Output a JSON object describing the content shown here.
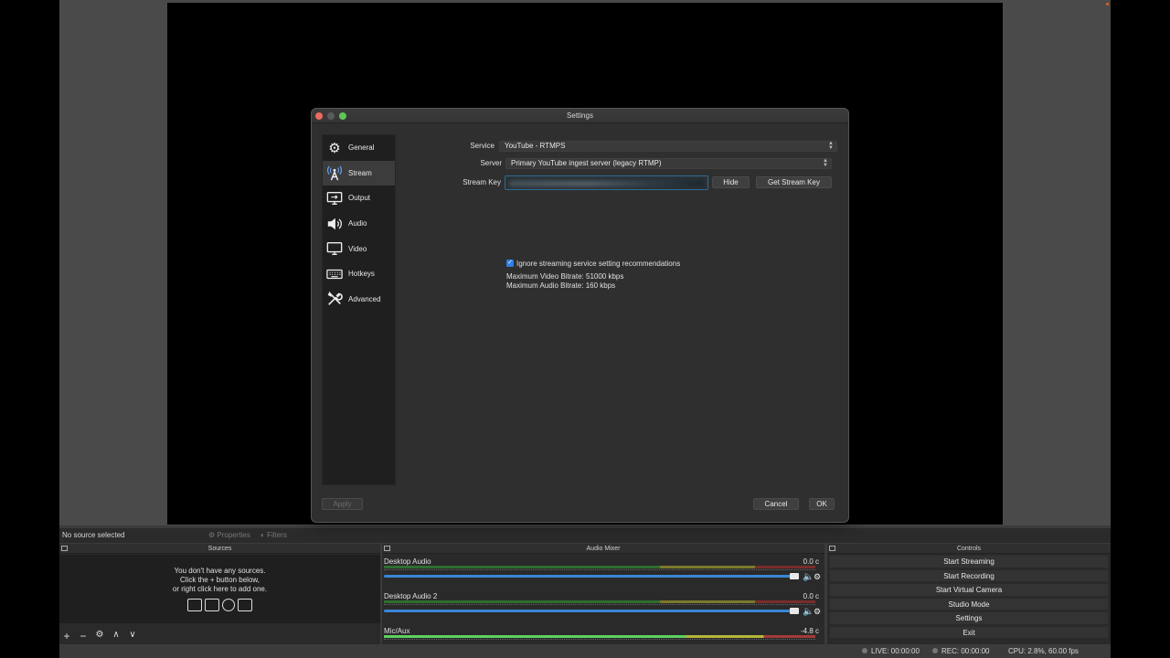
{
  "dialog": {
    "title": "Settings",
    "sidebar": [
      {
        "label": "General",
        "icon": "gear-icon"
      },
      {
        "label": "Stream",
        "icon": "antenna-icon"
      },
      {
        "label": "Output",
        "icon": "output-monitor-icon"
      },
      {
        "label": "Audio",
        "icon": "speaker-icon"
      },
      {
        "label": "Video",
        "icon": "display-icon"
      },
      {
        "label": "Hotkeys",
        "icon": "keyboard-icon"
      },
      {
        "label": "Advanced",
        "icon": "tools-icon"
      }
    ],
    "service_label": "Service",
    "service_value": "YouTube - RTMPS",
    "server_label": "Server",
    "server_value": "Primary YouTube ingest server (legacy RTMP)",
    "stream_key_label": "Stream Key",
    "hide_button": "Hide",
    "get_key_button": "Get Stream Key",
    "ignore_checkbox_label": "Ignore streaming service setting recommendations",
    "ignore_checked": true,
    "max_video_bitrate": "Maximum Video Bitrate: 51000 kbps",
    "max_audio_bitrate": "Maximum Audio Bitrate: 160 kbps",
    "apply_button": "Apply",
    "cancel_button": "Cancel",
    "ok_button": "OK"
  },
  "toolbar": {
    "no_source": "No source selected",
    "properties": "Properties",
    "filters": "Filters"
  },
  "sources": {
    "title": "Sources",
    "empty_line1": "You don't have any sources.",
    "empty_line2": "Click the + button below,",
    "empty_line3": "or right click here to add one."
  },
  "mixer": {
    "title": "Audio Mixer",
    "channels": [
      {
        "name": "Desktop Audio",
        "db": "0.0 c"
      },
      {
        "name": "Desktop Audio 2",
        "db": "0.0 c"
      },
      {
        "name": "Mic/Aux",
        "db": "-4.8 c"
      }
    ]
  },
  "controls": {
    "title": "Controls",
    "buttons": [
      "Start Streaming",
      "Start Recording",
      "Start Virtual Camera",
      "Studio Mode",
      "Settings",
      "Exit"
    ]
  },
  "status": {
    "live": "LIVE: 00:00:00",
    "rec": "REC: 00:00:00",
    "cpu": "CPU: 2.8%, 60.00 fps"
  },
  "colors": {
    "accent": "#2f7ee8",
    "fader": "#3a86d6",
    "window_bg": "#2f2f2f"
  }
}
